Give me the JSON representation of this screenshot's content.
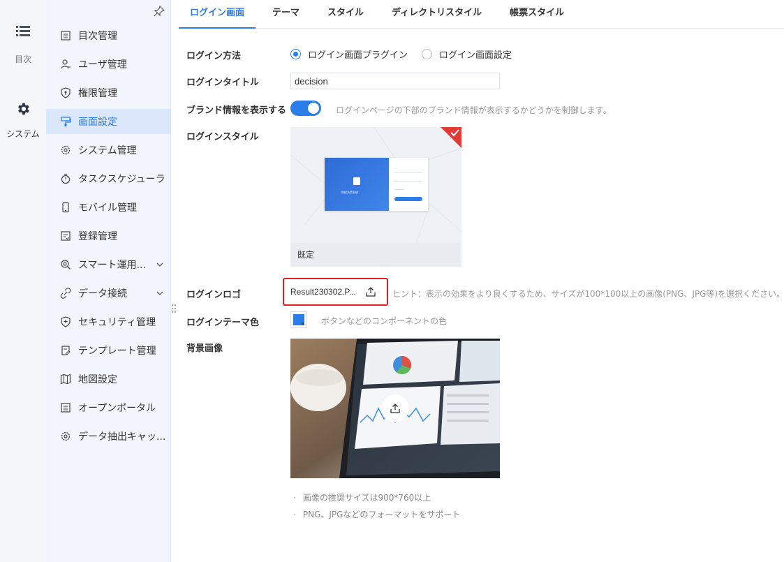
{
  "rail": {
    "items": [
      {
        "label": "目次",
        "icon": "list-icon"
      },
      {
        "label": "システム",
        "icon": "gear-icon"
      }
    ]
  },
  "sidebar": {
    "items": [
      {
        "label": "目次管理",
        "icon": "catalog-icon"
      },
      {
        "label": "ユーザ管理",
        "icon": "user-icon"
      },
      {
        "label": "権限管理",
        "icon": "permission-icon"
      },
      {
        "label": "画面設定",
        "icon": "appearance-icon",
        "active": true
      },
      {
        "label": "システム管理",
        "icon": "system-gear-icon"
      },
      {
        "label": "タスクスケジューラ",
        "icon": "timer-icon"
      },
      {
        "label": "モバイル管理",
        "icon": "mobile-icon"
      },
      {
        "label": "登録管理",
        "icon": "register-icon"
      },
      {
        "label": "スマート運用...",
        "icon": "smart-ops-icon"
      },
      {
        "label": "データ接続",
        "icon": "link-icon"
      },
      {
        "label": "セキュリティ管理",
        "icon": "shield-icon"
      },
      {
        "label": "テンプレート管理",
        "icon": "template-icon"
      },
      {
        "label": "地図設定",
        "icon": "map-icon"
      },
      {
        "label": "オープンポータル",
        "icon": "portal-icon"
      },
      {
        "label": "データ抽出キャッ...",
        "icon": "cache-gear-icon"
      }
    ]
  },
  "tabs": [
    {
      "label": "ログイン画面",
      "active": true
    },
    {
      "label": "テーマ"
    },
    {
      "label": "スタイル"
    },
    {
      "label": "ディレクトリスタイル"
    },
    {
      "label": "帳票スタイル"
    }
  ],
  "form": {
    "login_method": {
      "label": "ログイン方法",
      "options": [
        {
          "label": "ログイン画面プラグイン",
          "checked": true
        },
        {
          "label": "ログイン画面設定",
          "checked": false
        }
      ]
    },
    "login_title": {
      "label": "ログインタイトル",
      "value": "decision"
    },
    "brand_info": {
      "label": "ブランド情報を表示する",
      "enabled": true,
      "hint": "ログインページの下部のブランド情報が表示するかどうかを制御します。"
    },
    "login_style": {
      "label": "ログインスタイル",
      "card_caption": "既定",
      "preview_title": "数据决策系统"
    },
    "login_logo": {
      "label": "ログインロゴ",
      "file_name": "Result230302.P...",
      "hint": "ヒント：表示の効果をより良くするため、サイズが100*100以上の画像(PNG、JPG等)を選択ください。"
    },
    "theme_color": {
      "label": "ログインテーマ色",
      "color": "#2b7de9",
      "hint": "ボタンなどのコンポーネントの色"
    },
    "background_image": {
      "label": "背景画像",
      "notes": [
        "画像の推奨サイズは900*760以上",
        "PNG、JPGなどのフォーマットをサポート"
      ]
    }
  },
  "colors": {
    "accent": "#2b7de9",
    "highlight": "#e02020",
    "active_bg": "#dbe8fb"
  }
}
